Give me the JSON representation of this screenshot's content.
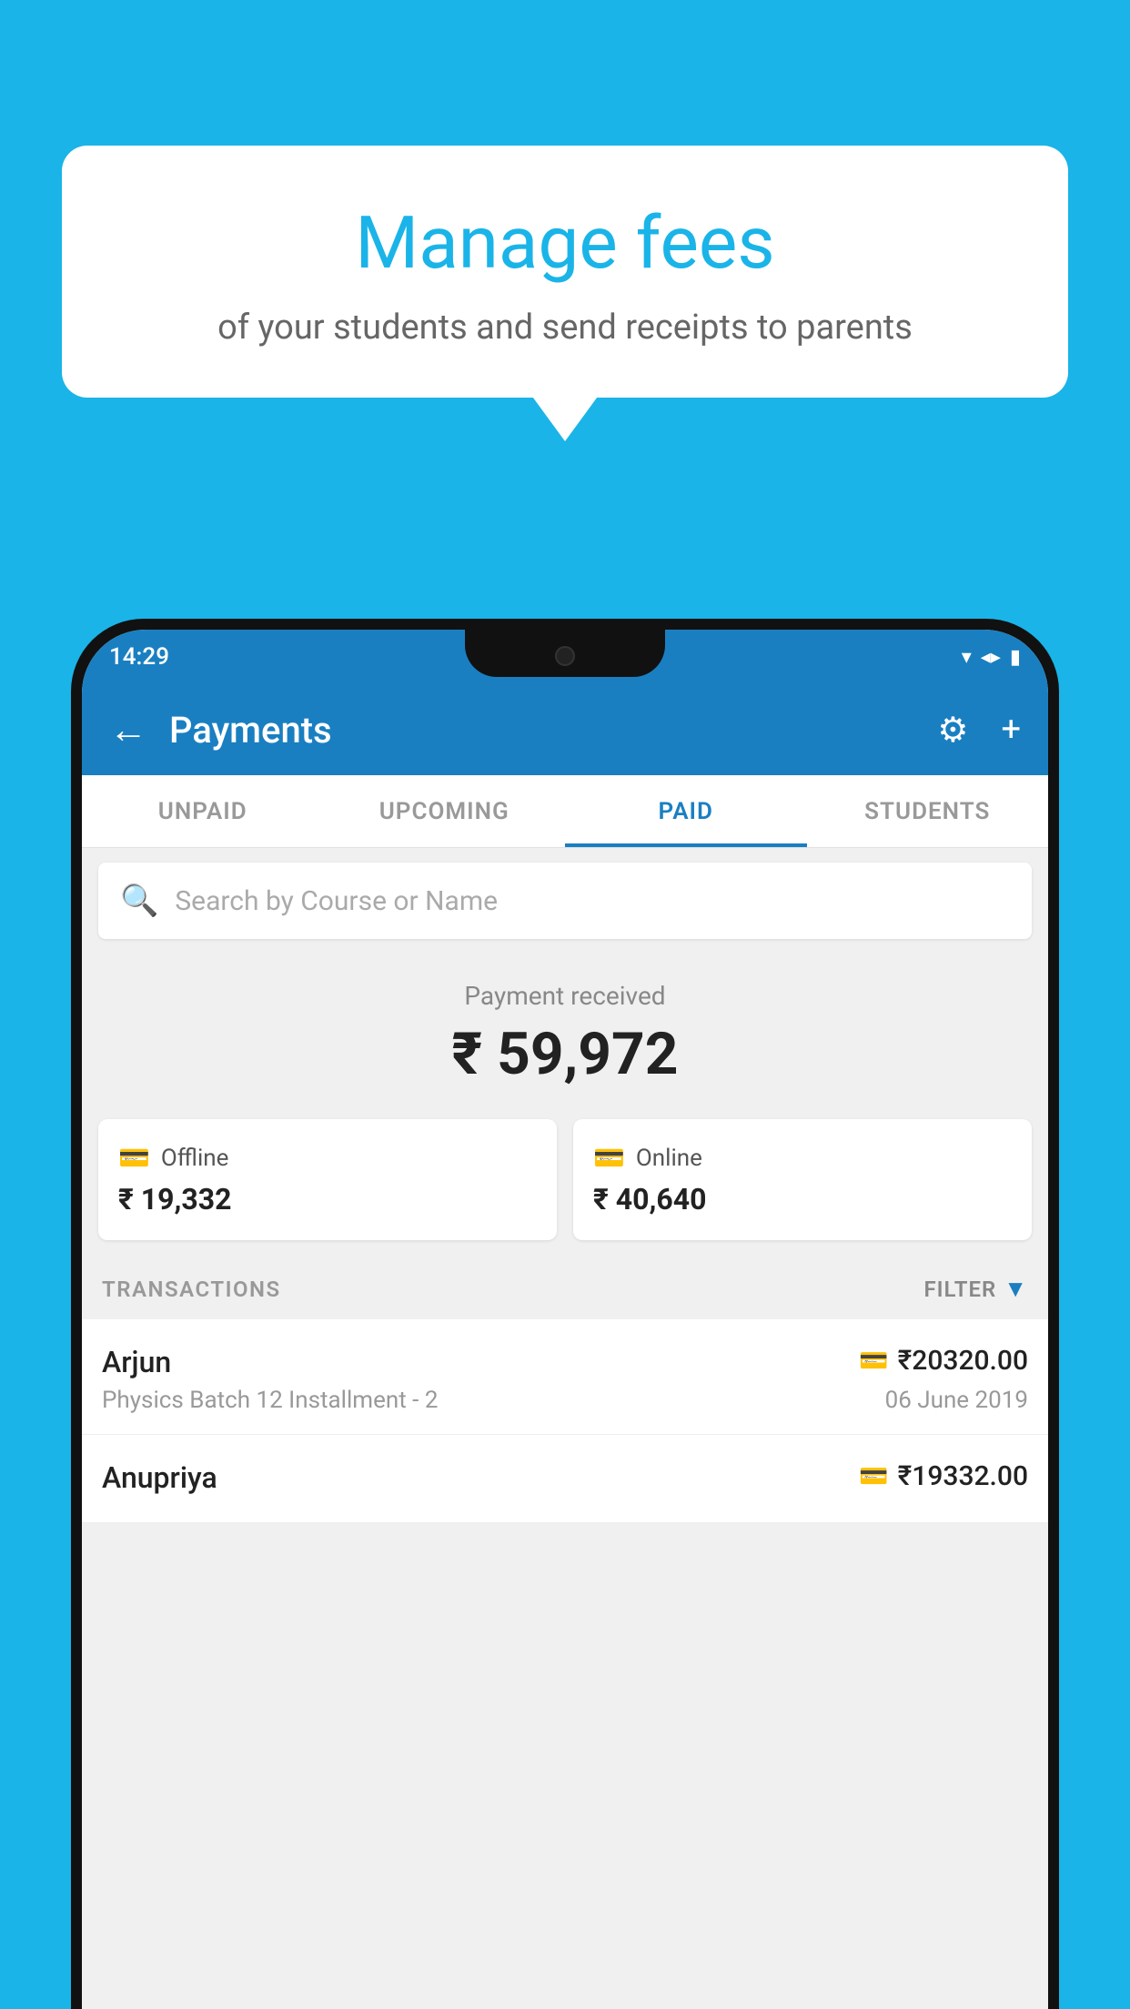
{
  "background": {
    "color": "#1ab4e8"
  },
  "speech_bubble": {
    "title": "Manage fees",
    "subtitle": "of your students and send receipts to parents"
  },
  "status_bar": {
    "time": "14:29",
    "icons": "▼◀▮"
  },
  "app_bar": {
    "title": "Payments",
    "back_icon": "←",
    "settings_icon": "⚙",
    "add_icon": "+"
  },
  "tabs": [
    {
      "label": "UNPAID",
      "active": false
    },
    {
      "label": "UPCOMING",
      "active": false
    },
    {
      "label": "PAID",
      "active": true
    },
    {
      "label": "STUDENTS",
      "active": false
    }
  ],
  "search": {
    "placeholder": "Search by Course or Name"
  },
  "payment_summary": {
    "label": "Payment received",
    "amount": "₹ 59,972"
  },
  "payment_cards": [
    {
      "icon": "💳",
      "label": "Offline",
      "amount": "₹ 19,332"
    },
    {
      "icon": "💳",
      "label": "Online",
      "amount": "₹ 40,640"
    }
  ],
  "transactions": {
    "label": "TRANSACTIONS",
    "filter_label": "FILTER"
  },
  "transaction_list": [
    {
      "name": "Arjun",
      "course": "Physics Batch 12 Installment - 2",
      "amount": "₹20320.00",
      "date": "06 June 2019",
      "icon": "💳"
    },
    {
      "name": "Anupriya",
      "course": "",
      "amount": "₹19332.00",
      "date": "",
      "icon": "💳"
    }
  ]
}
